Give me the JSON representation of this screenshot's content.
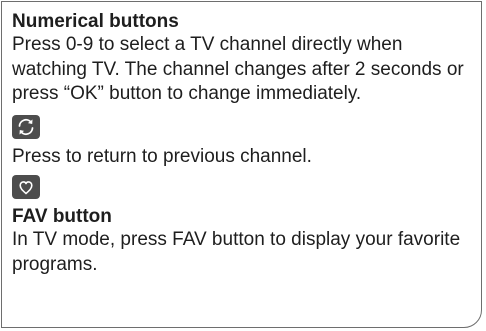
{
  "sections": {
    "numerical": {
      "title": "Numerical buttons",
      "text": "Press 0-9 to select a TV channel directly when watching TV. The channel changes after 2 seconds or press “OK” button to change immediately."
    },
    "recall": {
      "icon": "recall-arrows-icon",
      "text": "Press to return to previous channel."
    },
    "favorite_key": {
      "icon": "heart-icon"
    },
    "fav": {
      "title": "FAV button",
      "text": "In TV mode, press FAV button to display your favorite programs."
    }
  },
  "colors": {
    "key_background": "#4d4d4d",
    "key_glyph": "#ffffff",
    "border": "#6e6e6e",
    "text": "#1e1e1e"
  }
}
